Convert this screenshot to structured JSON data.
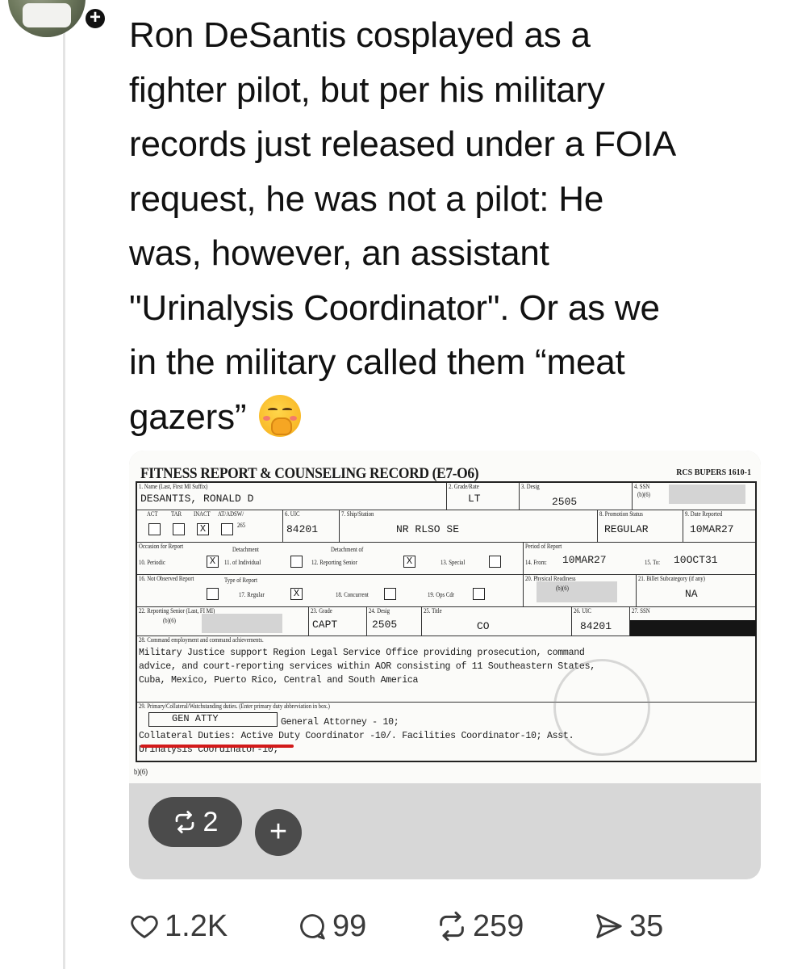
{
  "post": {
    "text_lines": [
      "Ron  DeSantis cosplayed as a",
      "fighter pilot, but per his military",
      "records just released under a FOIA",
      "request, he was not a pilot: He",
      "was, however,  an assistant",
      "\"Urinalysis Coordinator\". Or as we",
      "in the military called them “meat",
      "gazers”"
    ],
    "emoji": "face-with-hand-over-mouth"
  },
  "document": {
    "title": "FITNESS REPORT & COUNSELING RECORD (E7-O6)",
    "rcs": "RCS BUPERS 1610-1",
    "name_label": "1. Name (Last, First MI Suffix)",
    "name_value": "DESANTIS, RONALD D",
    "grade_label": "2. Grade/Rate",
    "grade_value": "LT",
    "desig_label": "3. Desig",
    "desig_value": "2505",
    "ssn_label": "4. SSN",
    "ssn_value": "(b)(6)",
    "act_labels": [
      "ACT",
      "TAR",
      "INACT",
      "AT/ADSW/"
    ],
    "act_x": "X",
    "act_265": "265",
    "uic_label": "6. UIC",
    "uic_value": "84201",
    "ship_label": "7. Ship/Station",
    "ship_value": "NR RLSO SE",
    "promo_label": "8. Promotion Status",
    "promo_value": "REGULAR",
    "date_label": "9. Date Reported",
    "date_value": "10MAR27",
    "occasion_label": "Occasion for Report",
    "periodic_label": "10. Periodic",
    "periodic_x": "X",
    "individual_label": "11. of Individual",
    "detachment_label": "Detachment",
    "detachment_rs_label": "Detachment of",
    "reporting_senior_label": "12. Reporting Senior",
    "rs_x": "X",
    "special_label": "13. Special",
    "period_label": "Period of Report",
    "from_label": "14. From:",
    "from_value": "10MAR27",
    "to_label": "15. To:",
    "to_value": "10OCT31",
    "not_observed_label": "16. Not Observed Report",
    "type_label": "Type of Report",
    "regular_label": "17. Regular",
    "regular_x": "X",
    "concurrent_label": "18. Concurrent",
    "opscdr_label": "19. Ops Cdr",
    "physical_label": "20. Physical Readiness",
    "physical_value": "(b)(6)",
    "billet_label": "21. Billet Subcategory (if any)",
    "billet_value": "NA",
    "rs_name_label": "22. Reporting Senior (Last, FI MI)",
    "rs_name_value": "(b)(6)",
    "rs_grade_label": "23. Grade",
    "rs_grade_value": "CAPT",
    "rs_desig_label": "24. Desig",
    "rs_desig_value": "2505",
    "rs_title_label": "25. Title",
    "rs_title_value": "CO",
    "rs_uic_label": "26. UIC",
    "rs_uic_value": "84201",
    "rs_ssn_label": "27. SSN",
    "cmd_label": "28. Command employment and command achievements.",
    "cmd_text": [
      "Military Justice support Region Legal Service Office providing prosecution, command",
      "advice, and court-reporting services within AOR consisting of 11 Southeastern States,",
      "Cuba, Mexico, Puerto Rico, Central and South America"
    ],
    "duties_label": "29. Primary/Collateral/Watchstanding duties. (Enter primary duty abbreviation in box.)",
    "duty_box": "GEN ATTY",
    "duties_text": [
      "General Attorney - 10;",
      "Collateral Duties: Active Duty Coordinator -10/. Facilities Coordinator-10; Asst.",
      "Urinalysis Coordinator-10;"
    ],
    "footer_mark": "b)(6)"
  },
  "media": {
    "repost_count": "2"
  },
  "actions": {
    "likes": "1.2K",
    "replies": "99",
    "reposts": "259",
    "shares": "35"
  }
}
